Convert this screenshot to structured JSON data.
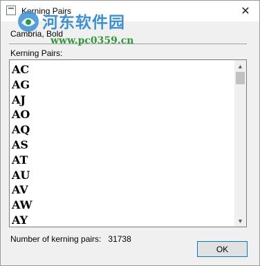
{
  "window": {
    "title": "Kerning Pairs",
    "close_glyph": "✕"
  },
  "font": {
    "name": "Cambria, Bold"
  },
  "watermark": {
    "text_cn": "河东软件园",
    "url": "www.pc0359.cn",
    "color_blue": "#3a8fd6",
    "color_green": "#2e9a3a"
  },
  "list": {
    "label": "Kerning Pairs:",
    "items": [
      "AC",
      "AG",
      "AJ",
      "AO",
      "AQ",
      "AS",
      "AT",
      "AU",
      "AV",
      "AW",
      "AY"
    ],
    "scroll_up_glyph": "▲",
    "scroll_down_glyph": "▼"
  },
  "footer": {
    "count_label": "Number of kerning pairs:",
    "count_value": "31738",
    "ok_label": "OK",
    "accent": "#0078d7"
  }
}
